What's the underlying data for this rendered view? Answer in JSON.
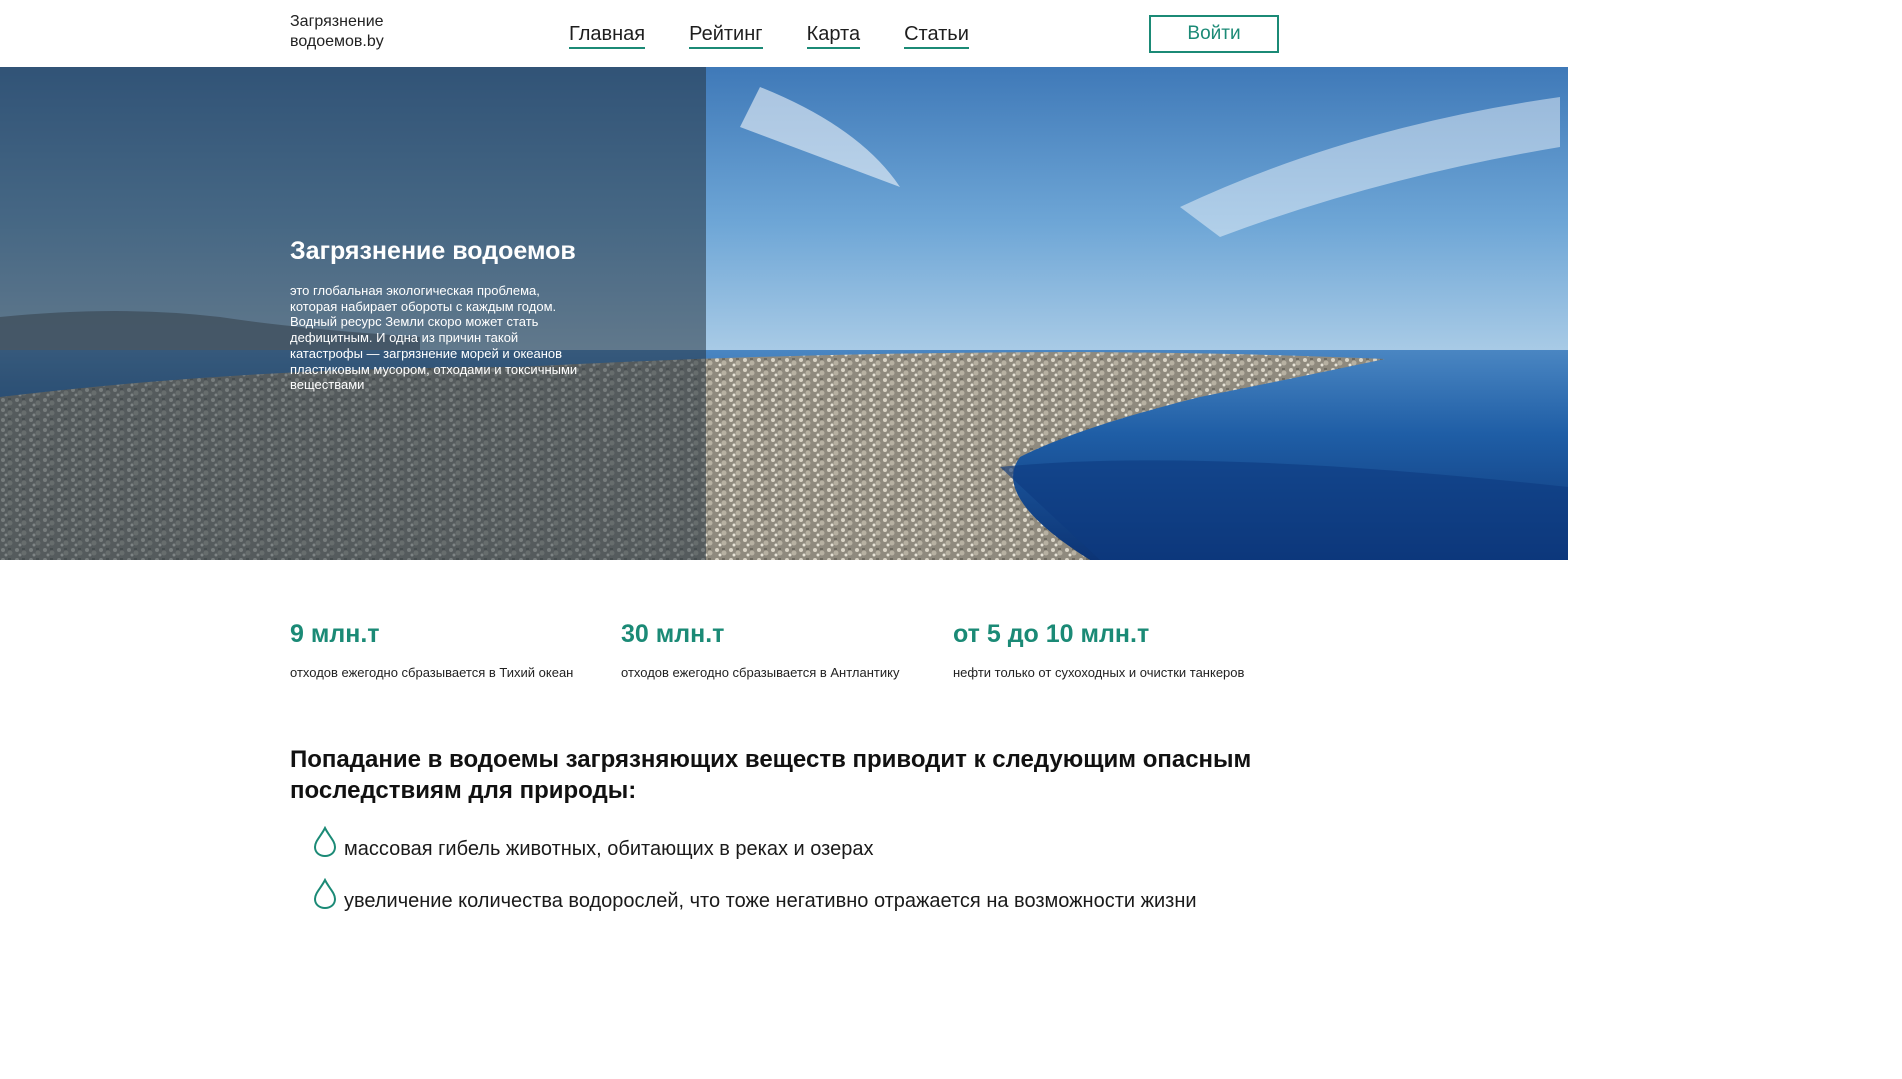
{
  "header": {
    "logo_line1": "Загрязнение",
    "logo_line2": "водоемов.by",
    "nav": [
      "Главная",
      "Рейтинг",
      "Карта",
      "Статьи"
    ],
    "login_label": "Войти"
  },
  "hero": {
    "title": "Загрязнение водоемов",
    "text": "это глобальная экологическая проблема, которая набирает обороты с каждым годом. Водный ресурс Земли скоро может стать дефицитным. И одна из причин такой катастрофы — загрязнение морей и океанов пластиковым мусором, отходами и токсичными веществами"
  },
  "stats": [
    {
      "value": "9 млн.т",
      "label": "отходов ежегодно сбразывается в Тихий океан"
    },
    {
      "value": "30 млн.т",
      "label": "отходов ежегодно сбразывается в Антлантику"
    },
    {
      "value": "от 5 до 10 млн.т",
      "label": "нефти только от сухоходных и очистки танкеров"
    }
  ],
  "consequences": {
    "title": "Попадание в водоемы загрязняющих веществ приводит к следующим опасным последствиям для природы:",
    "items": [
      "массовая гибель животных, обитающих в реках и озерах",
      "увеличение количества водорослей, что тоже негативно отражается на возможности жизни"
    ]
  },
  "colors": {
    "accent": "#1b8a76"
  },
  "icons": {
    "list_bullet": "water-drop-icon"
  }
}
